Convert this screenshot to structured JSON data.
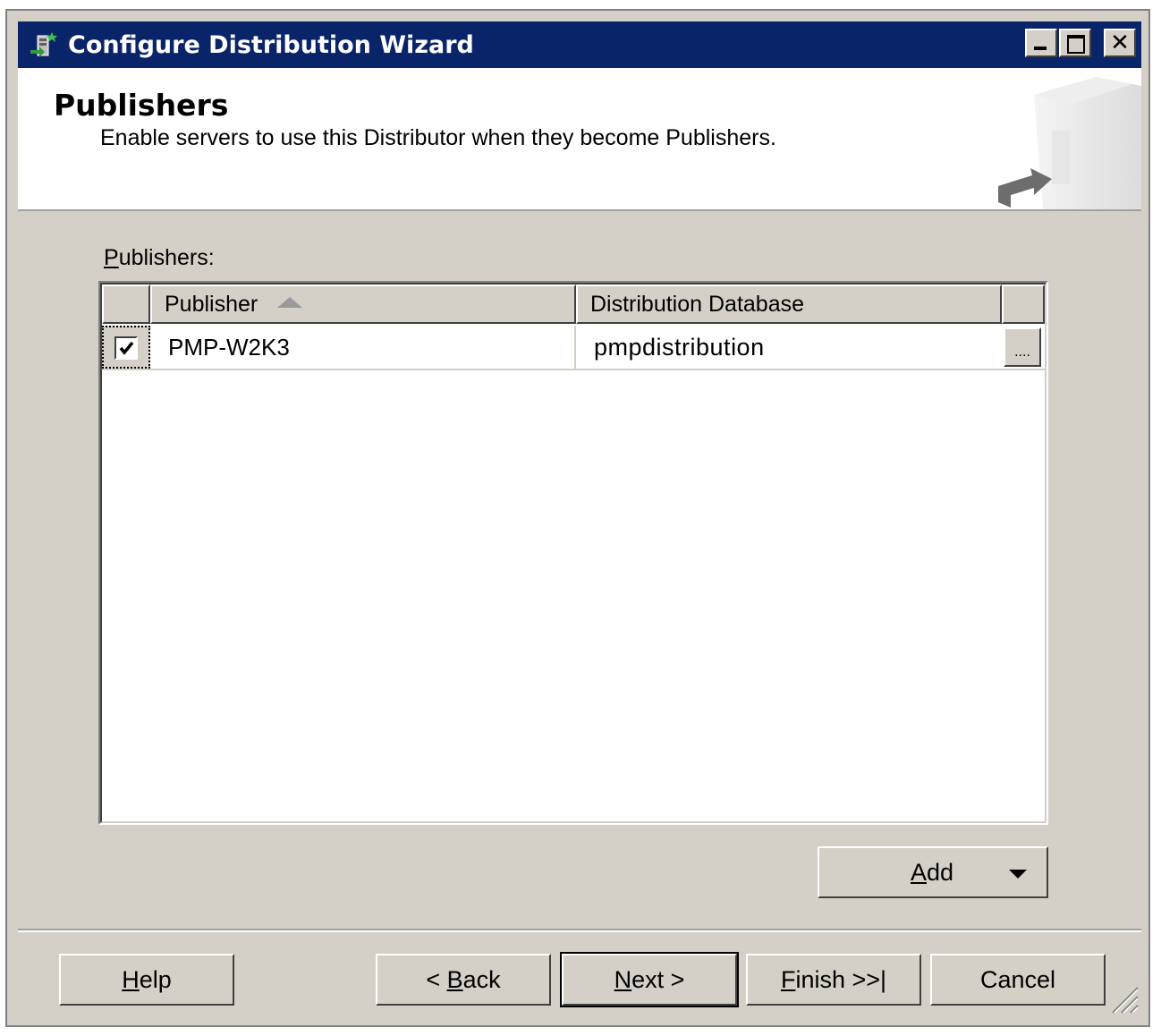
{
  "window": {
    "title": "Configure Distribution Wizard",
    "icons": {
      "app": "wizard-app-icon",
      "minimize": "minimize-icon",
      "maximize": "maximize-icon",
      "close": "close-icon"
    }
  },
  "header": {
    "title": "Publishers",
    "subtitle": "Enable servers to use this Distributor when they become Publishers.",
    "art": "server-arrow-graphic"
  },
  "publishers": {
    "label_underlined": "P",
    "label_rest": "ublishers:",
    "columns": [
      "Publisher",
      "Distribution Database"
    ],
    "sort": "ascending",
    "rows": [
      {
        "checked": true,
        "publisher": "PMP-W2K3",
        "distribution_database": "pmpdistribution",
        "browse_label": "...."
      }
    ]
  },
  "buttons": {
    "add": {
      "mnemonic": "A",
      "rest": "dd"
    },
    "help": {
      "mnemonic": "H",
      "rest": "elp"
    },
    "back": {
      "prefix": "< ",
      "mnemonic": "B",
      "rest": "ack"
    },
    "next": {
      "mnemonic": "N",
      "rest": "ext >"
    },
    "finish": {
      "mnemonic": "F",
      "rest": "inish >>|"
    },
    "cancel": "Cancel"
  },
  "colors": {
    "titlebar": "#0a246a",
    "face": "#d4d0c8",
    "window_bg": "#ffffff"
  }
}
